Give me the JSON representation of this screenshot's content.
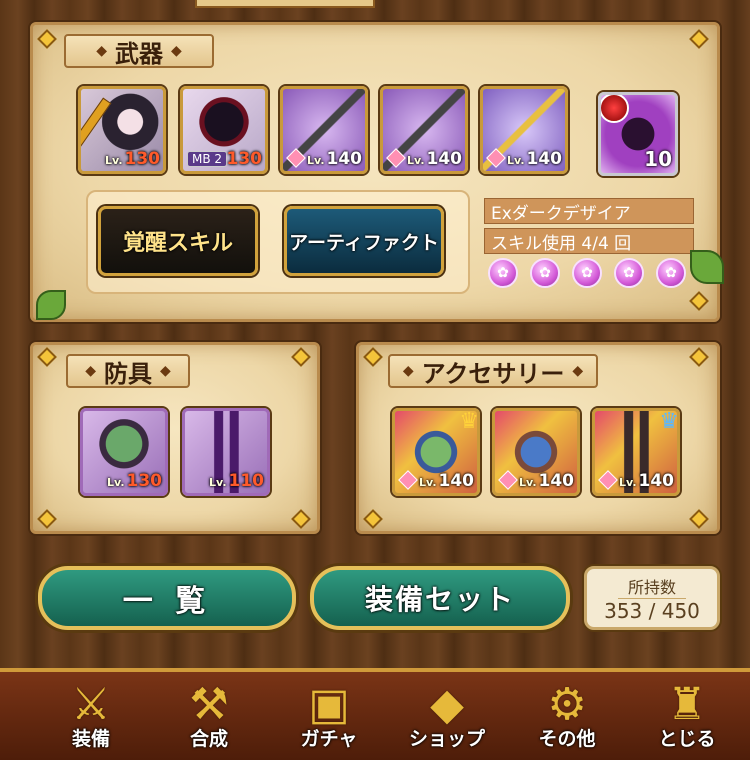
{
  "weapon": {
    "header": "武器",
    "cards": [
      {
        "name": "weapon-homura",
        "lv_label": "Lv.",
        "lv": "130",
        "mb": ""
      },
      {
        "name": "weapon-dark",
        "lv_label": "",
        "lv": "130",
        "mb": "MB 2"
      },
      {
        "name": "weapon-bow-1",
        "lv_label": "Lv.",
        "lv": "140",
        "mb": ""
      },
      {
        "name": "weapon-bow-2",
        "lv_label": "Lv.",
        "lv": "140",
        "mb": ""
      },
      {
        "name": "weapon-bow-3",
        "lv_label": "Lv.",
        "lv": "140",
        "mb": ""
      }
    ],
    "special_count": "10",
    "awaken_button": "覚醒スキル",
    "artifact_button": "アーティファクト",
    "skill_name": "Exダークデザイア",
    "skill_use": "スキル使用 4/4 回"
  },
  "armor": {
    "header": "防具",
    "cards": [
      {
        "lv_label": "Lv.",
        "lv": "130"
      },
      {
        "lv_label": "Lv.",
        "lv": "110"
      }
    ]
  },
  "accessory": {
    "header": "アクセサリー",
    "cards": [
      {
        "lv_label": "Lv.",
        "lv": "140"
      },
      {
        "lv_label": "Lv.",
        "lv": "140"
      },
      {
        "lv_label": "Lv.",
        "lv": "140"
      }
    ]
  },
  "actions": {
    "list_button": "一 覧",
    "equip_set_button": "装備セット",
    "owned_label": "所持数",
    "owned_value": "353 / 450"
  },
  "nav": [
    {
      "label": "装備",
      "icon": "equip-icon"
    },
    {
      "label": "合成",
      "icon": "hammer-icon"
    },
    {
      "label": "ガチャ",
      "icon": "gacha-icon"
    },
    {
      "label": "ショップ",
      "icon": "shop-crystal-icon"
    },
    {
      "label": "その他",
      "icon": "gear-icon"
    },
    {
      "label": "とじる",
      "icon": "close-statue-icon"
    }
  ]
}
